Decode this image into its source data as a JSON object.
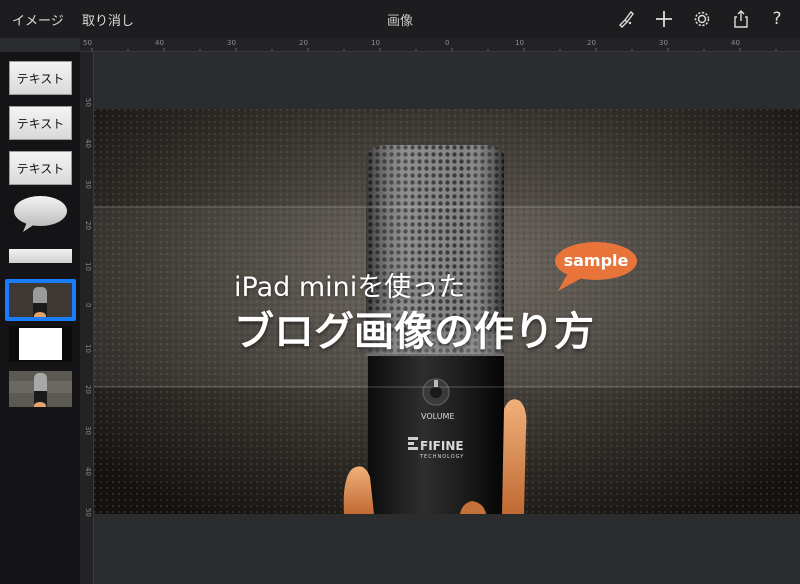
{
  "toolbar": {
    "back_label": "イメージ",
    "undo_label": "取り消し",
    "title": "画像",
    "icons": [
      "paint-brush-icon",
      "plus-icon",
      "gear-icon",
      "share-icon",
      "help-icon"
    ],
    "help_glyph": "?"
  },
  "ruler": {
    "top_ticks": [
      "50",
      "40",
      "30",
      "20",
      "10",
      "0",
      "10",
      "20",
      "30",
      "40"
    ],
    "left_ticks": [
      "50",
      "40",
      "30",
      "20",
      "10",
      "0",
      "10",
      "20",
      "30",
      "40",
      "50"
    ]
  },
  "sidebar": {
    "text_layers": [
      "テキスト",
      "テキスト",
      "テキスト"
    ]
  },
  "canvas": {
    "headline_small": "iPad miniを使った",
    "headline_large": "ブログ画像の作り方",
    "badge_text": "sample",
    "badge_color": "#e8743a",
    "mic_volume_label": "VOLUME",
    "mic_brand": "FIFINE",
    "mic_brand_sub": "TECHNOLOGY"
  },
  "colors": {
    "selection": "#1a7dff",
    "toolbar_bg": "#1d1d1f",
    "workspace_bg": "#2b2c2e"
  }
}
